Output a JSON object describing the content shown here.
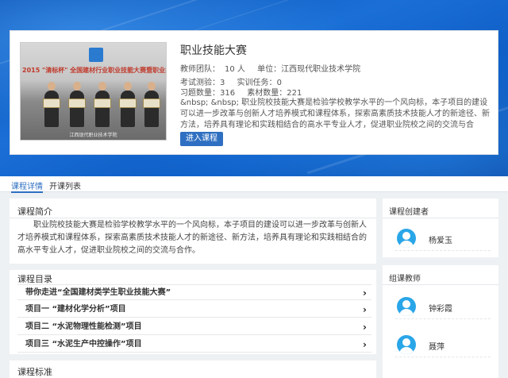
{
  "course": {
    "cover_title": "2015 \"清标杯\" 全国建材行业职业技能大赛暨职业技能大赛",
    "cover_caption": "江西现代职业技术学院",
    "title": "职业技能大赛",
    "team_label": "教师团队：",
    "team_value": "10 人",
    "unit_label": "单位：",
    "unit_value": "江西现代职业技术学院",
    "quiz_label": "考试测验：",
    "quiz_value": "3",
    "training_label": "实训任务：",
    "training_value": "0",
    "exercise_label": "习题数量：",
    "exercise_value": "316",
    "material_label": "素材数量：",
    "material_value": "221",
    "description": "&nbsp; &nbsp; 职业院校技能大赛是检验学校教学水平的一个风向标，本子项目的建设可以进一步改革与创新人才培养模式和课程体系，探索高素质技术技能人才的新途径、新方法，培养具有理论和实践相结合的高水平专业人才，促进职业院校之间的交流与合作。...",
    "enter_button": "进入课程"
  },
  "tabs": [
    {
      "label": "课程详情"
    },
    {
      "label": "开课列表"
    }
  ],
  "main": {
    "intro_title": "课程简介",
    "intro_text": "职业院校技能大赛是检验学校教学水平的一个风向标，本子项目的建设可以进一步改革与创新人才培养模式和课程体系，探索高素质技术技能人才的新途径、新方法，培养具有理论和实践相结合的高水平专业人才，促进职业院校之间的交流与合作。",
    "toc_title": "课程目录",
    "toc": [
      {
        "label": "带你走进“全国建材类学生职业技能大赛”"
      },
      {
        "label": "项目一 “建材化学分析”项目"
      },
      {
        "label": "项目二 “水泥物理性能检测”项目"
      },
      {
        "label": "项目三 “水泥生产中控操作”项目"
      }
    ],
    "standard_title": "课程标准"
  },
  "sidebar": {
    "creator_title": "课程创建者",
    "creators": [
      {
        "name": "杨爱玉"
      }
    ],
    "team_title": "组课教师",
    "teachers": [
      {
        "name": "钟彩霞"
      },
      {
        "name": "聂萍"
      }
    ]
  },
  "colors": {
    "accent": "#2f6fc1",
    "banner": "#1a6fd6",
    "avatar": "#2aa6e8"
  },
  "icons": {
    "chevron": "chevron-right-icon",
    "avatar": "user-avatar-icon"
  }
}
